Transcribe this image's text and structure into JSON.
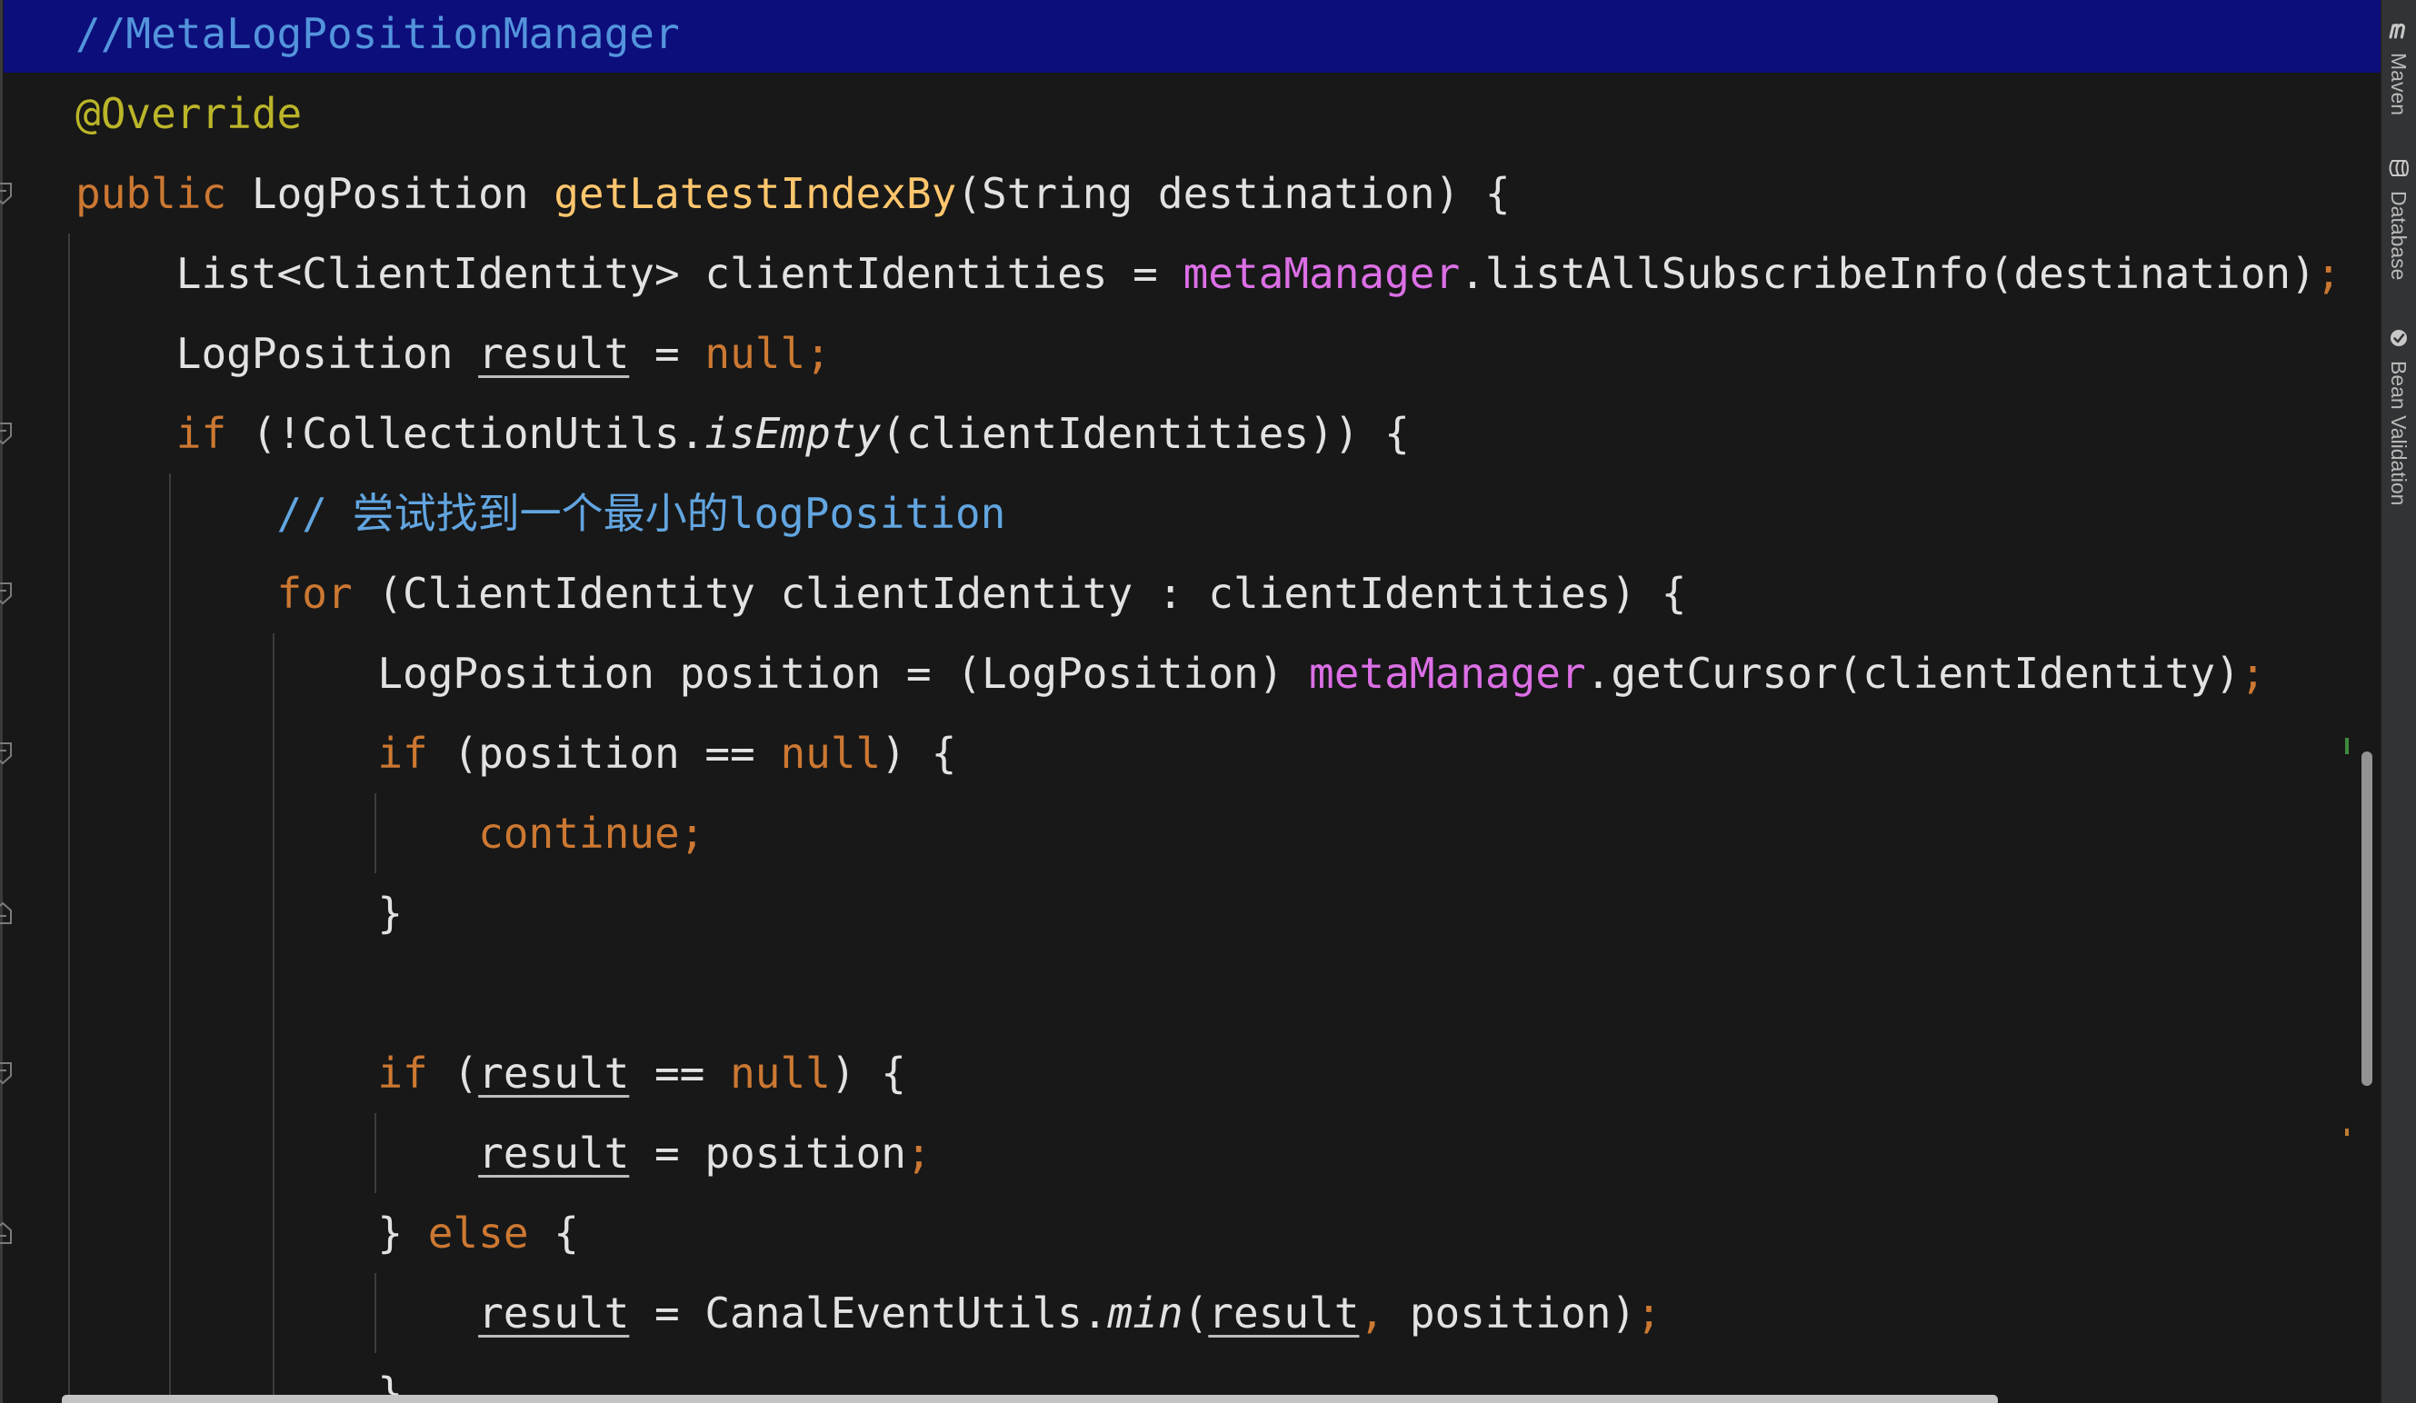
{
  "theme": {
    "editor_background": "#181818",
    "line_highlight": "#0c0e7b",
    "tool_strip_background": "#313335"
  },
  "editor": {
    "lines": [
      {
        "tokens": [
          {
            "text": "//MetaLogPositionManager",
            "color": "#5394dc"
          }
        ]
      },
      {
        "tokens": [
          {
            "text": "@Override",
            "color": "#bbb529"
          }
        ]
      },
      {
        "tokens": [
          {
            "text": "public ",
            "color": "#cc7832"
          },
          {
            "text": "LogPosition ",
            "color": "#e2e2e2"
          },
          {
            "text": "getLatestIndexBy",
            "color": "#ffc66d"
          },
          {
            "text": "(String destination) {",
            "color": "#e2e2e2"
          }
        ]
      },
      {
        "tokens": [
          {
            "text": "    List<ClientIdentity> clientIdentities = ",
            "color": "#e2e2e2"
          },
          {
            "text": "metaManager",
            "color": "#dc6fe6"
          },
          {
            "text": ".listAllSubscribeInfo(destination)",
            "color": "#e2e2e2"
          },
          {
            "text": ";",
            "color": "#cc7832"
          }
        ]
      },
      {
        "tokens": [
          {
            "text": "    LogPosition ",
            "color": "#e2e2e2"
          },
          {
            "text": "result",
            "color": "#e2e2e2",
            "underline": true
          },
          {
            "text": " = ",
            "color": "#e2e2e2"
          },
          {
            "text": "null;",
            "color": "#cc7832"
          }
        ]
      },
      {
        "tokens": [
          {
            "text": "    if ",
            "color": "#cc7832"
          },
          {
            "text": "(!CollectionUtils.",
            "color": "#e2e2e2"
          },
          {
            "text": "isEmpty",
            "color": "#e2e2e2",
            "italic": true
          },
          {
            "text": "(clientIdentities)) {",
            "color": "#e2e2e2"
          }
        ]
      },
      {
        "tokens": [
          {
            "text": "        // 尝试找到一个最小的logPosition",
            "color": "#62a5e0"
          }
        ]
      },
      {
        "tokens": [
          {
            "text": "        for ",
            "color": "#cc7832"
          },
          {
            "text": "(ClientIdentity clientIdentity : clientIdentities) {",
            "color": "#e2e2e2"
          }
        ]
      },
      {
        "tokens": [
          {
            "text": "            LogPosition position = (LogPosition) ",
            "color": "#e2e2e2"
          },
          {
            "text": "metaManager",
            "color": "#dc6fe6"
          },
          {
            "text": ".getCursor(clientIdentity)",
            "color": "#e2e2e2"
          },
          {
            "text": ";",
            "color": "#cc7832"
          }
        ]
      },
      {
        "tokens": [
          {
            "text": "            if ",
            "color": "#cc7832"
          },
          {
            "text": "(position == ",
            "color": "#e2e2e2"
          },
          {
            "text": "null",
            "color": "#cc7832"
          },
          {
            "text": ") {",
            "color": "#e2e2e2"
          }
        ]
      },
      {
        "tokens": [
          {
            "text": "                continue;",
            "color": "#cc7832"
          }
        ]
      },
      {
        "tokens": [
          {
            "text": "            }",
            "color": "#e2e2e2"
          }
        ]
      },
      {
        "tokens": []
      },
      {
        "tokens": [
          {
            "text": "            if ",
            "color": "#cc7832"
          },
          {
            "text": "(",
            "color": "#e2e2e2"
          },
          {
            "text": "result",
            "color": "#e2e2e2",
            "underline": true
          },
          {
            "text": " == ",
            "color": "#e2e2e2"
          },
          {
            "text": "null",
            "color": "#cc7832"
          },
          {
            "text": ") {",
            "color": "#e2e2e2"
          }
        ]
      },
      {
        "tokens": [
          {
            "text": "                ",
            "color": "#e2e2e2"
          },
          {
            "text": "result",
            "color": "#e2e2e2",
            "underline": true
          },
          {
            "text": " = position",
            "color": "#e2e2e2"
          },
          {
            "text": ";",
            "color": "#cc7832"
          }
        ]
      },
      {
        "tokens": [
          {
            "text": "            } ",
            "color": "#e2e2e2"
          },
          {
            "text": "else ",
            "color": "#cc7832"
          },
          {
            "text": "{",
            "color": "#e2e2e2"
          }
        ]
      },
      {
        "tokens": [
          {
            "text": "                ",
            "color": "#e2e2e2"
          },
          {
            "text": "result",
            "color": "#e2e2e2",
            "underline": true
          },
          {
            "text": " = CanalEventUtils.",
            "color": "#e2e2e2"
          },
          {
            "text": "min",
            "color": "#e2e2e2",
            "italic": true
          },
          {
            "text": "(",
            "color": "#e2e2e2"
          },
          {
            "text": "result",
            "color": "#e2e2e2",
            "underline": true
          },
          {
            "text": ",",
            "color": "#cc7832"
          },
          {
            "text": " position)",
            "color": "#e2e2e2"
          },
          {
            "text": ";",
            "color": "#cc7832"
          }
        ]
      },
      {
        "tokens": [
          {
            "text": "            }",
            "color": "#e2e2e2"
          }
        ]
      }
    ]
  },
  "tool_strip": {
    "items": [
      {
        "label": "Maven",
        "icon": "maven-icon"
      },
      {
        "label": "Database",
        "icon": "database-icon"
      },
      {
        "label": "Bean Validation",
        "icon": "bean-validation-icon"
      }
    ]
  }
}
